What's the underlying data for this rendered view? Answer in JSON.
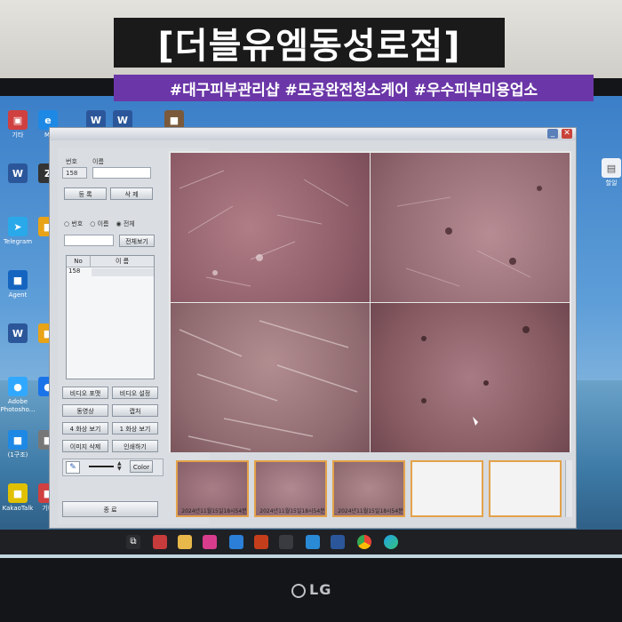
{
  "overlay": {
    "title": "[더블유엠동성로점]",
    "hashtags": "#대구피부관리샵 #모공완전청소케어 #우수피부미용업소"
  },
  "desktop": {
    "icons": [
      {
        "label": "기타",
        "color": "#d04040",
        "glyph": "▣"
      },
      {
        "label": "Mi",
        "color": "#1e88e5",
        "glyph": "e"
      },
      {
        "label": "",
        "color": "#2b579a",
        "glyph": "W"
      },
      {
        "label": "",
        "color": "#2b579a",
        "glyph": "W"
      },
      {
        "label": "",
        "color": "#7a5a3a",
        "glyph": "■"
      },
      {
        "label": "",
        "color": "#2b579a",
        "glyph": "W"
      },
      {
        "label": "",
        "color": "#333",
        "glyph": "Z"
      },
      {
        "label": "Telegram",
        "color": "#29a9ea",
        "glyph": "➤"
      },
      {
        "label": "",
        "color": "#e8a317",
        "glyph": "■"
      },
      {
        "label": "Agent",
        "color": "#1565c0",
        "glyph": "■"
      },
      {
        "label": "",
        "color": "#2b579a",
        "glyph": "W"
      },
      {
        "label": "",
        "color": "#e8a317",
        "glyph": "■"
      },
      {
        "label": "Adobe Photosho...",
        "color": "#31a8ff",
        "glyph": "●"
      },
      {
        "label": "",
        "color": "#1a73e8",
        "glyph": "●"
      },
      {
        "label": "(1구조)",
        "color": "#1e88e5",
        "glyph": "■"
      },
      {
        "label": "",
        "color": "#777",
        "glyph": "■"
      },
      {
        "label": "KakaoTalk",
        "color": "#e0c000",
        "glyph": "■"
      },
      {
        "label": "기타",
        "color": "#d04040",
        "glyph": "■"
      }
    ],
    "right_icon_label": "할일"
  },
  "app": {
    "left": {
      "labels": {
        "no": "번호",
        "name": "이름"
      },
      "number_value": "158",
      "name_value": "",
      "register_btn": "등 록",
      "delete_btn": "삭 제",
      "radio_options": [
        "번호",
        "이름",
        "전체"
      ],
      "radio_selected": "전체",
      "search_value": "",
      "view_all_btn": "전체보기",
      "list_headers": [
        "No",
        "이 름"
      ],
      "list_rows": [
        {
          "no": "158",
          "name": ""
        }
      ],
      "buttons": [
        {
          "left": "비디오 포맷",
          "right": "비디오 설정"
        },
        {
          "left": "동영상",
          "right": "캡처"
        },
        {
          "left": "4 화상 보기",
          "right": "1 화상 보기"
        },
        {
          "left": "이미지 삭제",
          "right": "인쇄하기"
        }
      ],
      "color_btn": "Color",
      "exit_btn": "종 료"
    },
    "thumbnails": [
      {
        "caption": "2024년11월15일18시54분",
        "filled": true
      },
      {
        "caption": "2024년11월15일18시54분",
        "filled": true
      },
      {
        "caption": "2024년11월15일18시54분",
        "filled": true
      },
      {
        "caption": "",
        "filled": false
      },
      {
        "caption": "",
        "filled": false
      }
    ]
  },
  "monitor": {
    "brand": "LG"
  }
}
